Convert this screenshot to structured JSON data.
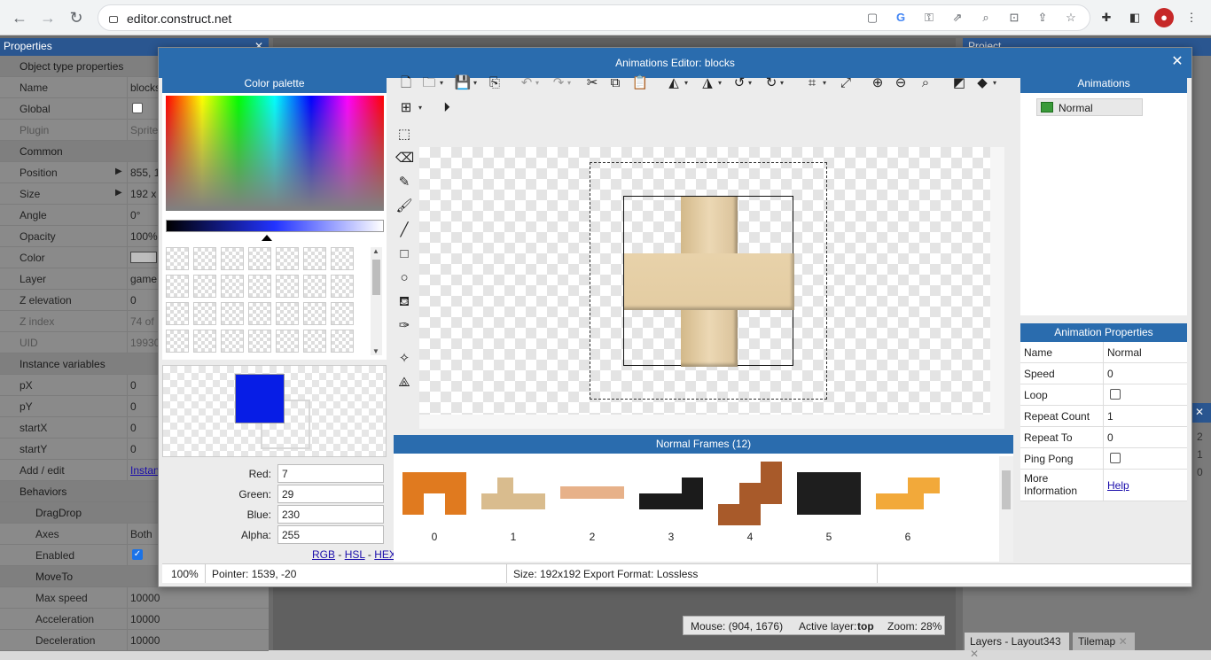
{
  "browser": {
    "url": "editor.construct.net"
  },
  "left_panel": {
    "title": "Properties",
    "section_object": "Object type properties",
    "rows": [
      {
        "k": "Name",
        "v": "blocks"
      },
      {
        "k": "Global",
        "v": ""
      },
      {
        "k": "Plugin",
        "v": "Sprite"
      },
      {
        "k": "Common",
        "v": ""
      },
      {
        "k": "Position",
        "v": "855, 1"
      },
      {
        "k": "Size",
        "v": "192 x"
      },
      {
        "k": "Angle",
        "v": "0°"
      },
      {
        "k": "Opacity",
        "v": "100%"
      },
      {
        "k": "Color",
        "v": ""
      },
      {
        "k": "Layer",
        "v": "game"
      },
      {
        "k": "Z elevation",
        "v": "0"
      },
      {
        "k": "Z index",
        "v": "74 of"
      },
      {
        "k": "UID",
        "v": "19930"
      },
      {
        "k": "Instance variables",
        "v": ""
      },
      {
        "k": "pX",
        "v": "0"
      },
      {
        "k": "pY",
        "v": "0"
      },
      {
        "k": "startX",
        "v": "0"
      },
      {
        "k": "startY",
        "v": "0"
      },
      {
        "k": "Add / edit",
        "v": "Instan"
      },
      {
        "k": "Behaviors",
        "v": ""
      },
      {
        "k": "DragDrop",
        "v": ""
      },
      {
        "k": "Axes",
        "v": "Both"
      },
      {
        "k": "Enabled",
        "v": ""
      },
      {
        "k": "MoveTo",
        "v": ""
      },
      {
        "k": "Max speed",
        "v": "10000"
      },
      {
        "k": "Acceleration",
        "v": "10000"
      },
      {
        "k": "Deceleration",
        "v": "10000"
      }
    ]
  },
  "right_panel_title": "Project",
  "dialog": {
    "title": "Animations Editor: blocks",
    "color_palette_title": "Color palette",
    "channels": [
      {
        "label": "Red:",
        "value": "7"
      },
      {
        "label": "Green:",
        "value": "29"
      },
      {
        "label": "Blue:",
        "value": "230"
      },
      {
        "label": "Alpha:",
        "value": "255"
      }
    ],
    "format_links": [
      "RGB",
      "HSL",
      "HEX"
    ],
    "primary_color": "#071de6",
    "frames_title": "Normal Frames (12)",
    "frames": [
      {
        "num": "0",
        "color": "#e07a1f"
      },
      {
        "num": "1",
        "color": "#d9bc8e"
      },
      {
        "num": "2",
        "color": "#e7b189"
      },
      {
        "num": "3",
        "color": "#1b1b1b"
      },
      {
        "num": "4",
        "color": "#a85a2a"
      },
      {
        "num": "5",
        "color": "#1e1e1e"
      },
      {
        "num": "6",
        "color": "#f2a93a"
      }
    ],
    "animations_title": "Animations",
    "animations": [
      "Normal"
    ],
    "anim_props_title": "Animation Properties",
    "anim_props": [
      {
        "k": "Name",
        "v": "Normal"
      },
      {
        "k": "Speed",
        "v": "0"
      },
      {
        "k": "Loop",
        "v": ""
      },
      {
        "k": "Repeat Count",
        "v": "1"
      },
      {
        "k": "Repeat To",
        "v": "0"
      },
      {
        "k": "Ping Pong",
        "v": ""
      },
      {
        "k": "More Information",
        "v": "Help"
      }
    ],
    "status": {
      "zoom": "100%",
      "pointer": "Pointer: 1539, -20",
      "size": "Size: 192x192",
      "export": "Export Format: Lossless"
    }
  },
  "layout_status": {
    "mouse": "Mouse: (904, 1676)",
    "active_layer_label": "Active layer:",
    "active_layer": "top",
    "zoom": "Zoom: 28%"
  },
  "bottom_tabs": [
    "Layers - Layout343",
    "Tilemap"
  ],
  "side_numbers": [
    "2",
    "1",
    "0"
  ]
}
